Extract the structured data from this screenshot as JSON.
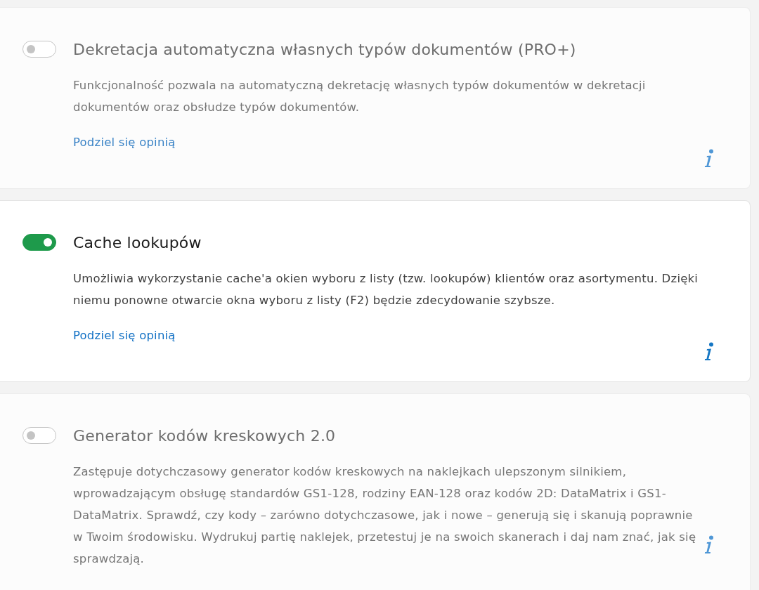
{
  "cards": [
    {
      "title": "Dekretacja automatyczna własnych typów dokumentów (PRO+)",
      "on": false,
      "dimmed": true,
      "description": "Funkcjonalność pozwala na automatyczną dekretację własnych typów dokumentów w dekretacji dokumentów oraz obsłudze typów dokumentów.",
      "link": "Podziel się opinią"
    },
    {
      "title": "Cache lookupów",
      "on": true,
      "dimmed": false,
      "description": "Umożliwia wykorzystanie cache'a okien wyboru z listy (tzw. lookupów) klientów oraz asortymentu. Dzięki niemu ponowne otwarcie okna wyboru z listy (F2) będzie zdecydowanie szybsze.",
      "link": "Podziel się opinią"
    },
    {
      "title": "Generator kodów kreskowych 2.0",
      "on": false,
      "dimmed": true,
      "description": "Zastępuje dotychczasowy generator kodów kreskowych na naklejkach ulepszonym silnikiem, wprowadzającym obsługę standardów GS1-128, rodziny EAN-128 oraz kodów 2D: DataMatrix i GS1-DataMatrix. Sprawdź, czy kody – zarówno dotychczasowe, jak i nowe – generują się i skanują poprawnie w Twoim środowisku. Wydrukuj partię naklejek, przetestuj je na swoich skanerach i daj nam znać, jak się sprawdzają."
    }
  ]
}
